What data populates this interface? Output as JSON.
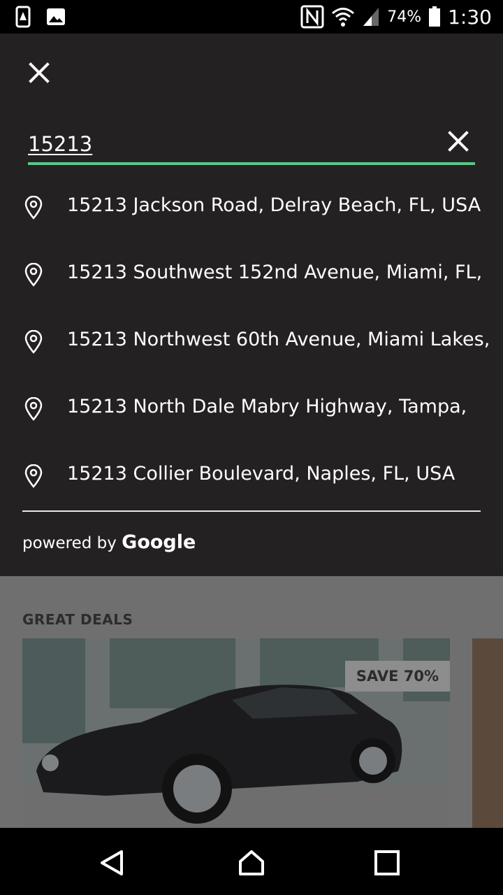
{
  "status_bar": {
    "battery": "74%",
    "time": "1:30",
    "icons": [
      "sim-icon",
      "image-icon",
      "nfc-icon",
      "wifi-icon",
      "signal-icon",
      "battery-icon"
    ]
  },
  "search": {
    "value": "15213",
    "accent_color": "#58c78a"
  },
  "results": [
    "15213 Jackson Road, Delray Beach, FL, USA",
    "15213 Southwest 152nd Avenue, Miami, FL,",
    "15213 Northwest 60th Avenue, Miami Lakes,",
    "15213 North Dale Mabry Highway, Tampa,",
    "15213 Collier Boulevard, Naples, FL, USA"
  ],
  "attribution": {
    "prefix": "powered by",
    "brand": "Google"
  },
  "deals": {
    "title": "GREAT DEALS",
    "badge": "SAVE 70%"
  }
}
